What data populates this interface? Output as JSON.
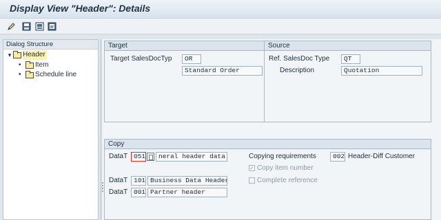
{
  "window": {
    "title": "Display View \"Header\": Details"
  },
  "toolbar": {
    "buttons": [
      "edit-icon",
      "save-icon",
      "save-as-icon",
      "export-icon"
    ]
  },
  "dialog_structure": {
    "heading": "Dialog Structure",
    "items": [
      {
        "label": "Header",
        "expander": "▾",
        "selected": true
      },
      {
        "label": "Item",
        "bullet": "•"
      },
      {
        "label": "Schedule line",
        "bullet": "•"
      }
    ]
  },
  "target": {
    "heading": "Target",
    "sales_doc_type_label": "Target SalesDocTyp",
    "sales_doc_type_value": "OR",
    "description_value": "Standard Order"
  },
  "source": {
    "heading": "Source",
    "ref_type_label": "Ref. SalesDoc Type",
    "ref_type_value": "QT",
    "description_label": "Description",
    "description_value": "Quotation"
  },
  "copy": {
    "heading": "Copy",
    "rows": [
      {
        "label": "DataT",
        "code": "051",
        "text": "neral header data"
      },
      {
        "label": "DataT",
        "code": "101",
        "text": "Business Data Header"
      },
      {
        "label": "DataT",
        "code": "001",
        "text": "Partner header"
      }
    ],
    "requirements_label": "Copying requirements",
    "requirements_code": "002",
    "requirements_text": "Header-Diff Customer",
    "copy_item_number_label": "Copy item number",
    "copy_item_number_mark": "✓",
    "complete_reference_label": "Complete reference"
  }
}
